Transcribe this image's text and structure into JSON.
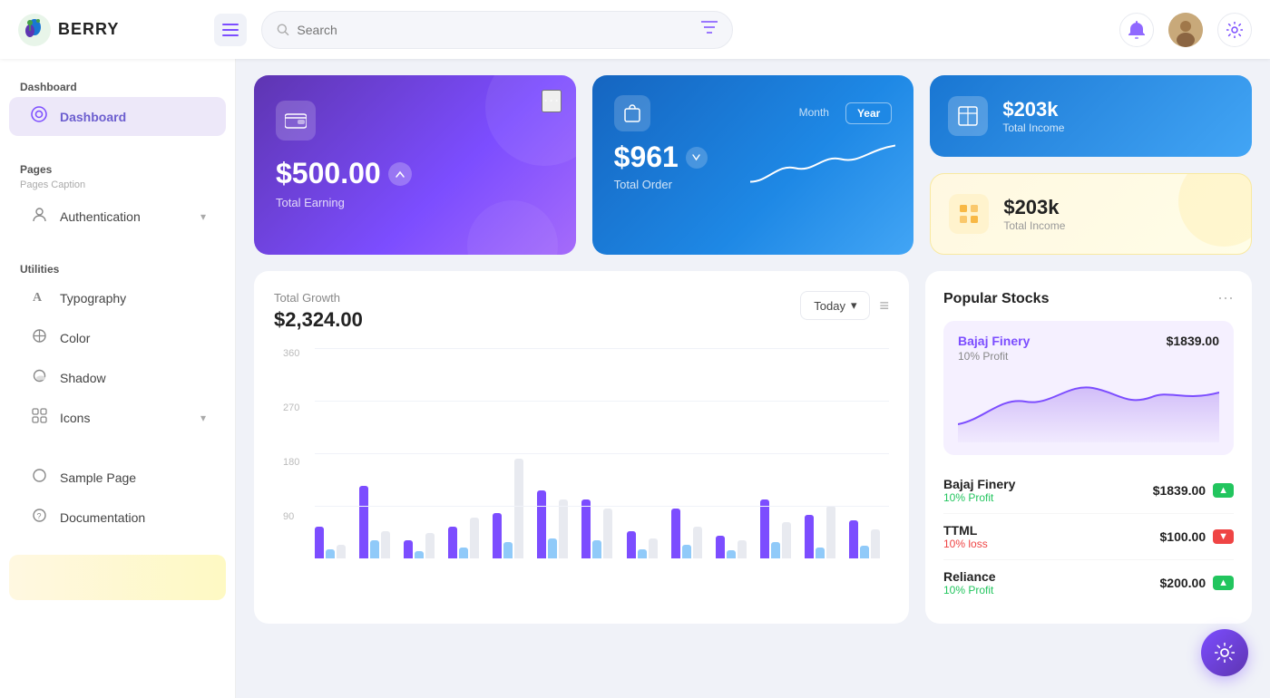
{
  "app": {
    "logo_text": "BERRY",
    "logo_emoji": "🫐"
  },
  "header": {
    "search_placeholder": "Search",
    "hamburger_label": "☰",
    "bell_icon": "🔔",
    "settings_icon": "⚙️",
    "avatar_emoji": "👤"
  },
  "sidebar": {
    "dashboard_section": "Dashboard",
    "dashboard_item": "Dashboard",
    "pages_section": "Pages",
    "pages_caption": "Pages Caption",
    "authentication_label": "Authentication",
    "utilities_section": "Utilities",
    "typography_label": "Typography",
    "color_label": "Color",
    "shadow_label": "Shadow",
    "icons_label": "Icons",
    "sample_page_label": "Sample Page",
    "documentation_label": "Documentation"
  },
  "cards": {
    "earning": {
      "amount": "$500.00",
      "label": "Total Earning",
      "badge": "↗"
    },
    "order": {
      "amount": "$961",
      "label": "Total Order",
      "badge": "↙",
      "tab_month": "Month",
      "tab_year": "Year"
    },
    "income_blue": {
      "amount": "$203k",
      "label": "Total Income"
    },
    "income_yellow": {
      "amount": "$203k",
      "label": "Total Income"
    }
  },
  "chart": {
    "title": "Total Growth",
    "amount": "$2,324.00",
    "button_label": "Today",
    "y_labels": [
      "360",
      "270",
      "180",
      "90"
    ],
    "bars": [
      {
        "purple": 35,
        "blue": 10,
        "light": 15
      },
      {
        "purple": 80,
        "blue": 20,
        "light": 30
      },
      {
        "purple": 15,
        "blue": 8,
        "light": 25
      },
      {
        "purple": 30,
        "blue": 12,
        "light": 40
      },
      {
        "purple": 45,
        "blue": 15,
        "light": 100
      },
      {
        "purple": 70,
        "blue": 20,
        "light": 60
      },
      {
        "purple": 65,
        "blue": 22,
        "light": 50
      },
      {
        "purple": 25,
        "blue": 8,
        "light": 20
      },
      {
        "purple": 50,
        "blue": 12,
        "light": 30
      },
      {
        "purple": 20,
        "blue": 8,
        "light": 18
      },
      {
        "purple": 60,
        "blue": 15,
        "light": 35
      },
      {
        "purple": 45,
        "blue": 10,
        "light": 55
      },
      {
        "purple": 40,
        "blue": 12,
        "light": 30
      }
    ]
  },
  "stocks": {
    "section_title": "Popular Stocks",
    "featured": {
      "name": "Bajaj Finery",
      "price": "$1839.00",
      "profit": "10% Profit"
    },
    "items": [
      {
        "name": "Bajaj Finery",
        "price": "$1839.00",
        "profit": "10% Profit",
        "trend": "up"
      },
      {
        "name": "TTML",
        "price": "$100.00",
        "profit": "10% loss",
        "trend": "down"
      },
      {
        "name": "Reliance",
        "price": "$200.00",
        "profit": "10% Profit",
        "trend": "up"
      }
    ]
  },
  "fab": {
    "icon": "⚙️"
  }
}
